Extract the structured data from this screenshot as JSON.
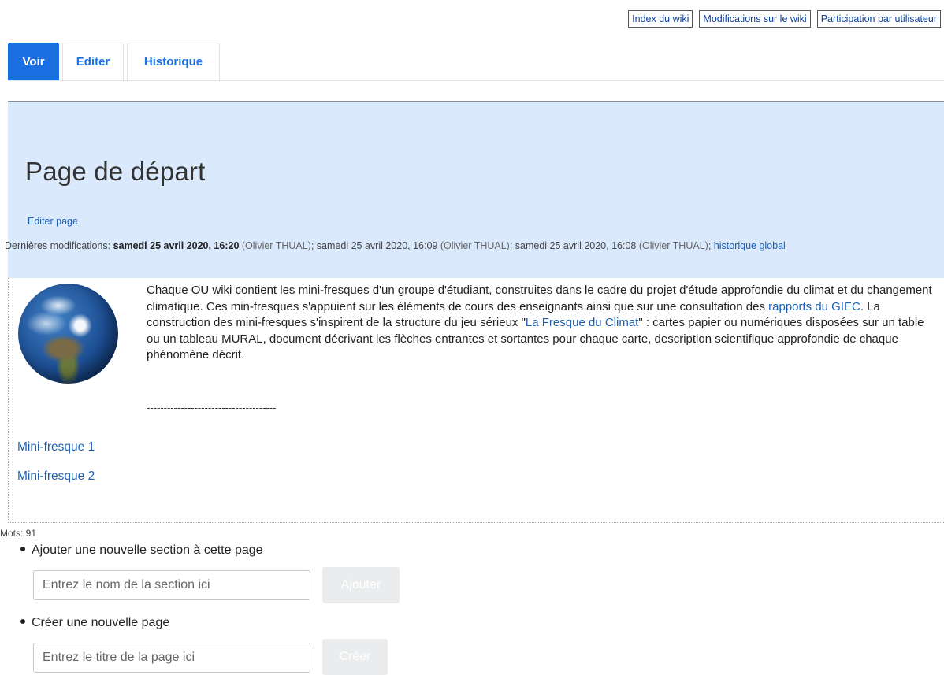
{
  "topnav": {
    "index": "Index du wiki",
    "changes": "Modifications sur le wiki",
    "participation": "Participation par utilisateur"
  },
  "tabs": [
    {
      "label": "Voir",
      "active": true
    },
    {
      "label": "Editer",
      "active": false
    },
    {
      "label": "Historique",
      "active": false
    }
  ],
  "header": {
    "title": "Page de départ",
    "edit_link": "Editer page",
    "lastmod_prefix": "Dernières modifications: ",
    "mod1_date": "samedi 25 avril 2020, 16:20",
    "mod1_user": " (Olivier THUAL)",
    "sep1": "; samedi 25 avril 2020, 16:09",
    "mod2_user": " (Olivier THUAL)",
    "sep2": "; samedi 25 avril 2020, 16:08",
    "mod3_user": " (Olivier THUAL)",
    "sep3": "; ",
    "history_link": "historique global"
  },
  "content": {
    "image_alt": "globe-earth-image",
    "intro_part1": "Chaque OU wiki contient les mini-fresques d'un groupe d'étudiant, construites dans le cadre du projet d'étude approfondie du climat et du changement climatique. Ces min-fresques s'appuient sur les éléments de cours des enseignants ainsi que sur une consultation des ",
    "giec_link": "rapports du GIEC",
    "intro_part2": ". La construction des mini-fresques s'inspirent de la structure du jeu sérieux \"",
    "fresque_link": "La Fresque du Climat",
    "intro_part3": "\" : cartes papier ou numériques disposées sur un table ou un tableau MURAL, document décrivant les flèches entrantes et sortantes pour chaque carte, description scientifique approfondie de chaque phénomène décrit.",
    "dashes": "--------------------------------------",
    "links": [
      "Mini-fresque 1",
      "Mini-fresque 2"
    ]
  },
  "footer": {
    "words": "Mots: 91",
    "add_section_label": "Ajouter une nouvelle section à cette page",
    "add_section_placeholder": "Entrez le nom de la section ici",
    "add_section_button": "Ajouter",
    "create_page_label": "Créer une nouvelle page",
    "create_page_placeholder": "Entrez le titre de la page ici",
    "create_page_button": "Créer"
  },
  "colors": {
    "header_bg": "#dbe9fd",
    "active_tab": "#1a6fe0",
    "link": "#1a5fb4"
  }
}
